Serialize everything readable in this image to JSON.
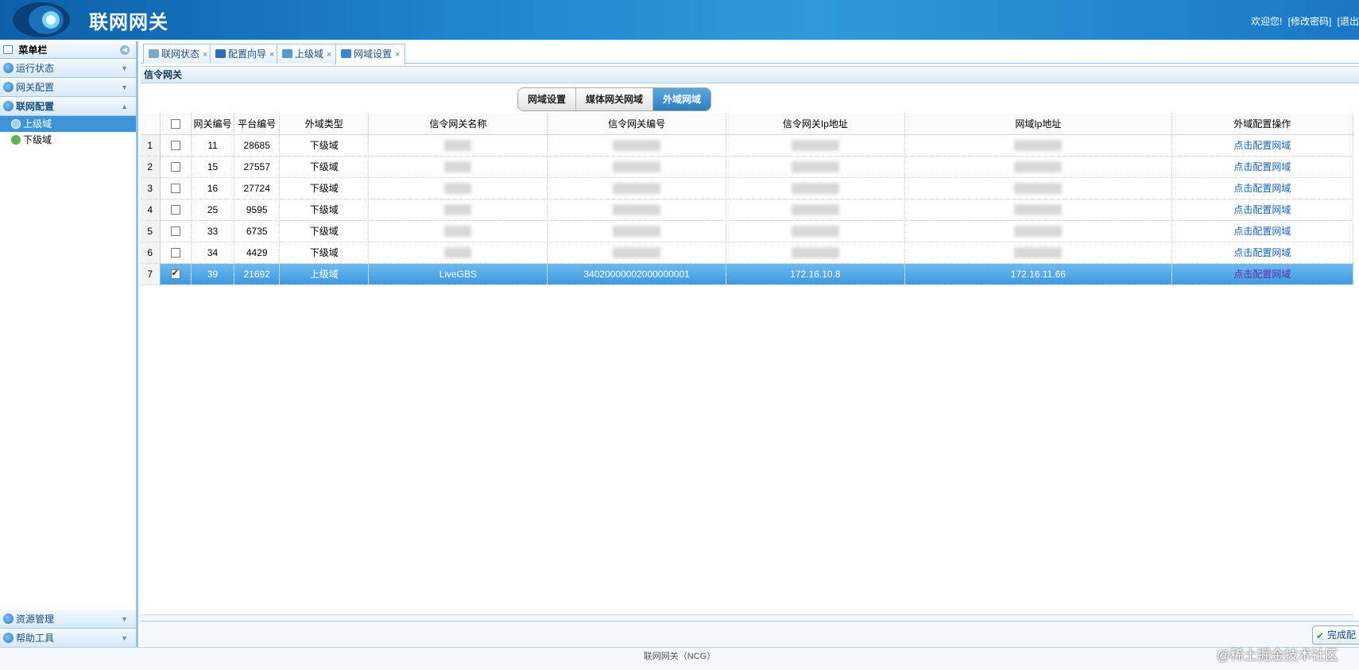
{
  "header": {
    "app_title": "联网网关",
    "welcome": "欢迎您!",
    "change_password": "[修改密码]",
    "logout": "[退出"
  },
  "sidebar": {
    "title": "菜单栏",
    "sections_top": [
      {
        "label": "运行状态",
        "arrow": "▼"
      },
      {
        "label": "网关配置",
        "arrow": "▼"
      },
      {
        "label": "联网配置",
        "arrow": "▲"
      }
    ],
    "sub_items": [
      {
        "label": "上级域",
        "selected": true
      },
      {
        "label": "下级域",
        "selected": false
      }
    ],
    "sections_bottom": [
      {
        "label": "资源管理",
        "arrow": "▼"
      },
      {
        "label": "帮助工具",
        "arrow": "▼"
      }
    ]
  },
  "tabs": [
    {
      "label": "联网状态",
      "close": "×",
      "icon": "network-icon",
      "color": "#7aa7cc"
    },
    {
      "label": "配置向导",
      "close": "×",
      "icon": "arrow-right-icon",
      "color": "#2d6fb5"
    },
    {
      "label": "上级域",
      "close": "×",
      "icon": "up-domain-icon",
      "color": "#4d9ad9"
    },
    {
      "label": "网域设置",
      "close": "×",
      "icon": "domain-settings-icon",
      "color": "#3a86c8"
    }
  ],
  "panel": {
    "title": "信令网关"
  },
  "segments": [
    {
      "label": "网域设置",
      "active": false
    },
    {
      "label": "媒体网关网域",
      "active": false
    },
    {
      "label": "外域网域",
      "active": true
    }
  ],
  "table": {
    "columns": [
      "网关编号",
      "平台编号",
      "外域类型",
      "信令网关名称",
      "信令网关编号",
      "信令网关Ip地址",
      "网域Ip地址",
      "外域配置操作"
    ],
    "rows": [
      {
        "num": "1",
        "checked": false,
        "gw_id": "11",
        "platform_id": "28685",
        "type": "下级域",
        "name": "",
        "code": "",
        "sig_ip": "",
        "domain_ip": "",
        "action": "点击配置网域",
        "selected": false
      },
      {
        "num": "2",
        "checked": false,
        "gw_id": "15",
        "platform_id": "27557",
        "type": "下级域",
        "name": "",
        "code": "",
        "sig_ip": "",
        "domain_ip": "",
        "action": "点击配置网域",
        "selected": false
      },
      {
        "num": "3",
        "checked": false,
        "gw_id": "16",
        "platform_id": "27724",
        "type": "下级域",
        "name": "",
        "code": "",
        "sig_ip": "",
        "domain_ip": "",
        "action": "点击配置网域",
        "selected": false
      },
      {
        "num": "4",
        "checked": false,
        "gw_id": "25",
        "platform_id": "9595",
        "type": "下级域",
        "name": "",
        "code": "",
        "sig_ip": "",
        "domain_ip": "",
        "action": "点击配置网域",
        "selected": false
      },
      {
        "num": "5",
        "checked": false,
        "gw_id": "33",
        "platform_id": "6735",
        "type": "下级域",
        "name": "",
        "code": "",
        "sig_ip": "",
        "domain_ip": "",
        "action": "点击配置网域",
        "selected": false
      },
      {
        "num": "6",
        "checked": false,
        "gw_id": "34",
        "platform_id": "4429",
        "type": "下级域",
        "name": "",
        "code": "",
        "sig_ip": "",
        "domain_ip": "",
        "action": "点击配置网域",
        "selected": false
      },
      {
        "num": "7",
        "checked": true,
        "gw_id": "39",
        "platform_id": "21692",
        "type": "上级域",
        "name": "LiveGBS",
        "code": "34020000002000000001",
        "sig_ip": "172.16.10.8",
        "domain_ip": "172.16.11.66",
        "action": "点击配置网域",
        "selected": true
      }
    ]
  },
  "done_button": {
    "label": "完成配"
  },
  "footer": {
    "text": "联网网关（NCG）"
  },
  "watermark": {
    "text": "@稀土掘金技术社区"
  }
}
